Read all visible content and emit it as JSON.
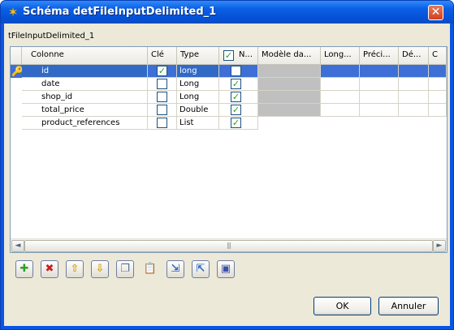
{
  "window": {
    "title": "Schéma detFileInputDelimited_1",
    "component": "tFileInputDelimited_1"
  },
  "table": {
    "headers": [
      "Colonne",
      "Clé",
      "Type",
      "N...",
      "Modèle da...",
      "Long...",
      "Préci...",
      "Dé...",
      "C"
    ],
    "rows": [
      {
        "name": "id",
        "key": true,
        "type": "long",
        "nullable": false
      },
      {
        "name": "date",
        "key": false,
        "type": "Long",
        "nullable": true
      },
      {
        "name": "shop_id",
        "key": false,
        "type": "Long",
        "nullable": true
      },
      {
        "name": "total_price",
        "key": false,
        "type": "Double",
        "nullable": true
      },
      {
        "name": "product_references",
        "key": false,
        "type": "List",
        "nullable": true
      }
    ],
    "header_checkbox_checked": true,
    "scrollbar_grip": "|||"
  },
  "toolbar": {
    "icons": [
      "add-icon",
      "delete-icon",
      "move-up-icon",
      "move-down-icon",
      "copy-icon",
      "paste-icon",
      "import-icon",
      "export-icon",
      "save-icon"
    ]
  },
  "buttons": {
    "ok": "OK",
    "cancel": "Annuler"
  },
  "glyphs": {
    "close": "✕",
    "star": "✶",
    "check": "✓",
    "key": "🔑",
    "left": "◄",
    "right": "►"
  }
}
